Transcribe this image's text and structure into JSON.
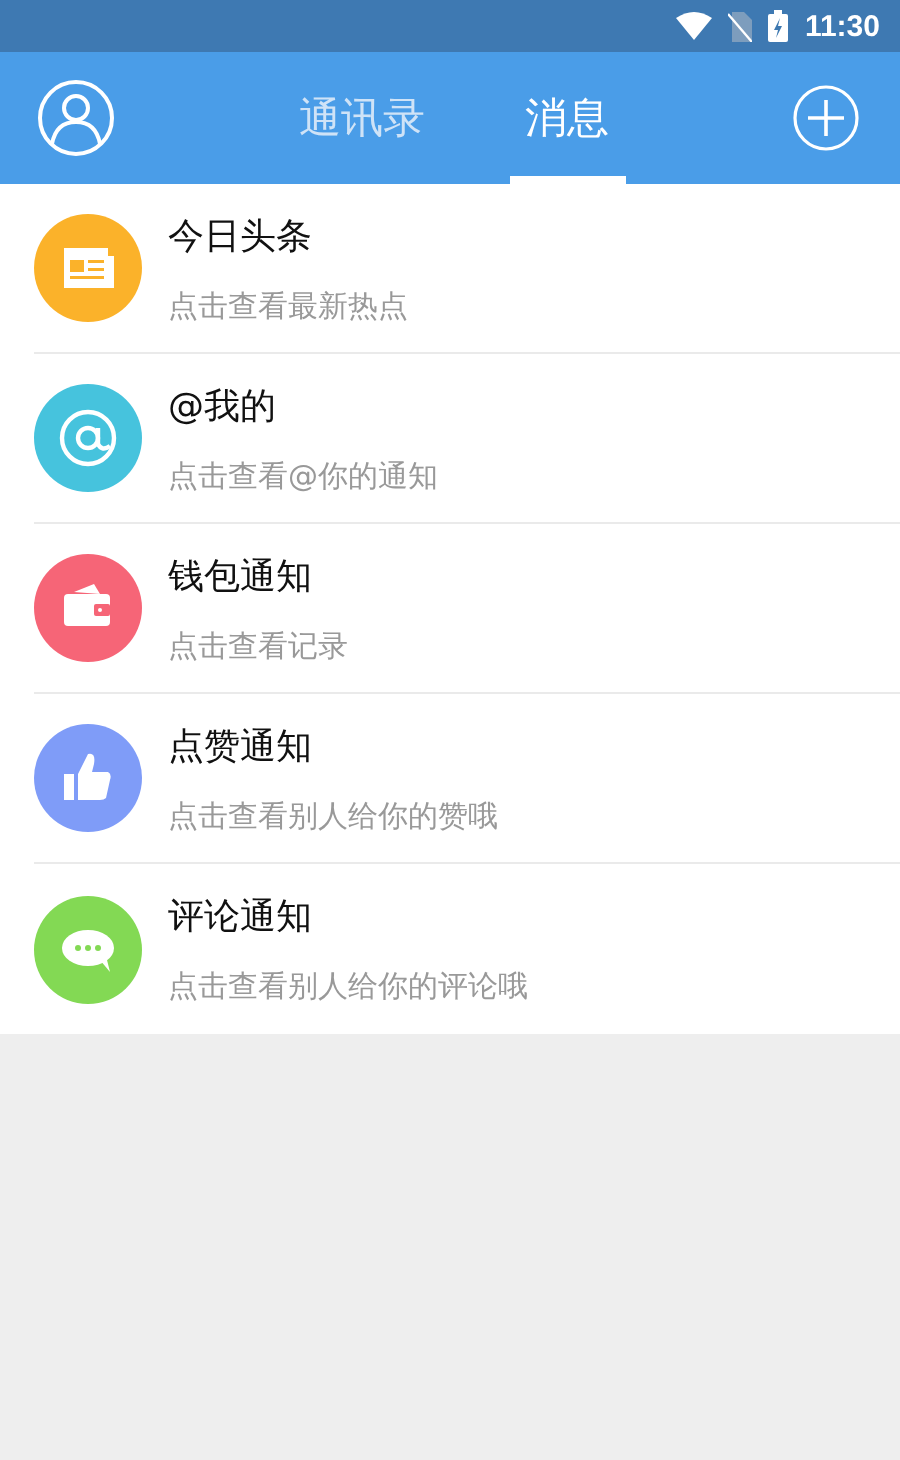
{
  "status_bar": {
    "time": "11:30"
  },
  "tabs": [
    {
      "label": "通讯录",
      "selected": false
    },
    {
      "label": "消息",
      "selected": true
    }
  ],
  "messages": [
    {
      "kind": "news",
      "color": "#fbb22a",
      "title": "今日头条",
      "subtitle": "点击查看最新热点"
    },
    {
      "kind": "at",
      "color": "#46c3dd",
      "title": "@我的",
      "subtitle": "点击查看@你的通知"
    },
    {
      "kind": "wallet",
      "color": "#f66577",
      "title": "钱包通知",
      "subtitle": "点击查看记录"
    },
    {
      "kind": "like",
      "color": "#7f9cf8",
      "title": "点赞通知",
      "subtitle": "点击查看别人给你的赞哦"
    },
    {
      "kind": "comment",
      "color": "#83d954",
      "title": "评论通知",
      "subtitle": "点击查看别人给你的评论哦"
    }
  ]
}
